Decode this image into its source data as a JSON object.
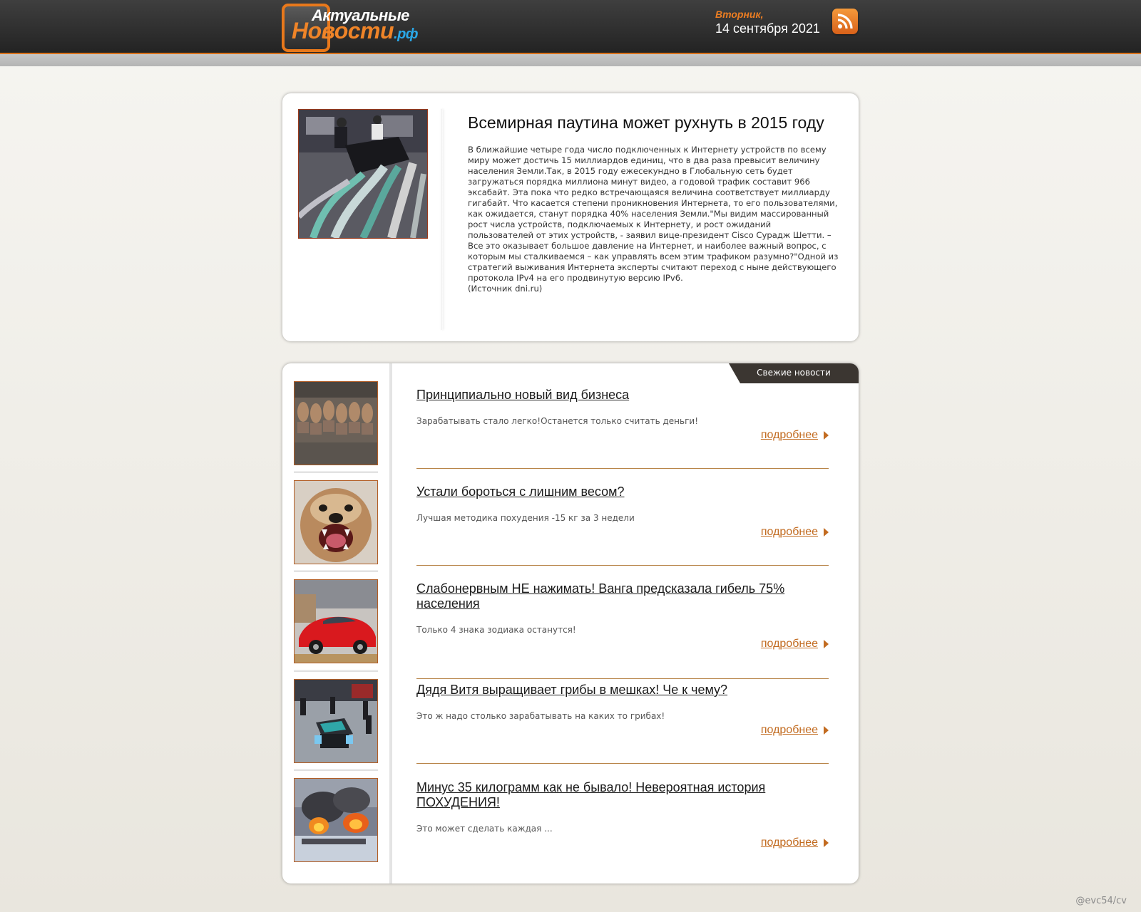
{
  "header": {
    "logo_line1": "Актуальные",
    "logo_line2": "Новости",
    "logo_rf": ".рф",
    "date_day": "Вторник,",
    "date_full": "14 сентября 2021"
  },
  "featured": {
    "title": "Всемирная паутина может рухнуть в 2015 году",
    "text": "В ближайшие четыре года число подключенных к Интернету устройств по всему миру может достичь 15 миллиардов единиц, что в два раза превысит величину населения Земли.Так, в 2015 году ежесекундно в Глобальную сеть будет загружаться порядка миллиона минут видео, а годовой трафик составит 966 эксабайт. Эта пока что редко встречающаяся величина соответствует миллиарду гигабайт. Что касается степени проникновения Интернета, то его пользователями, как ожидается, станут порядка 40% населения Земли.\"Мы видим массированный рост числа устройств, подключаемых к Интернету, и рост ожиданий пользователей от этих устройств, - заявил вице-президент Cisco Сурадж Шетти. – Все это оказывает большое давление на Интернет, и наиболее важный вопрос, с которым мы сталкиваемся – как управлять всем этим трафиком разумно?\"Одной из стратегий выживания Интернета эксперты считают переход с ныне действующего протокола IPv4 на его продвинутую версию IPv6.",
    "source": "(Источник dni.ru)"
  },
  "news": {
    "tab_label": "Свежие новости",
    "more_label": "подробнее",
    "items": [
      {
        "title": "Принципиально новый вид бизнеса",
        "desc": "Зарабатывать стало легко!Останется только считать деньги!"
      },
      {
        "title": "Устали бороться с лишним весом?",
        "desc": "Лучшая методика похудения -15 кг за 3 недели"
      },
      {
        "title": "Слабонервным НЕ нажимать! Ванга предсказала гибель 75% населения",
        "desc": "Только 4 знака зодиака останутся!"
      },
      {
        "title": "Дядя Витя выращивает грибы в мешках! Че к чему?",
        "desc": "Это ж надо столько зарабатывать на каких то грибах!"
      },
      {
        "title": "Минус 35 килограмм как не бывало! Невероятная история ПОХУДЕНИЯ!",
        "desc": "Это может сделать каждая ..."
      }
    ]
  },
  "watermark": "@evc54/cv",
  "colors": {
    "accent": "#ec7d22",
    "link_more": "#c26b20",
    "header_bg": "#2e2e2e",
    "tab_bg": "#3b3631"
  }
}
